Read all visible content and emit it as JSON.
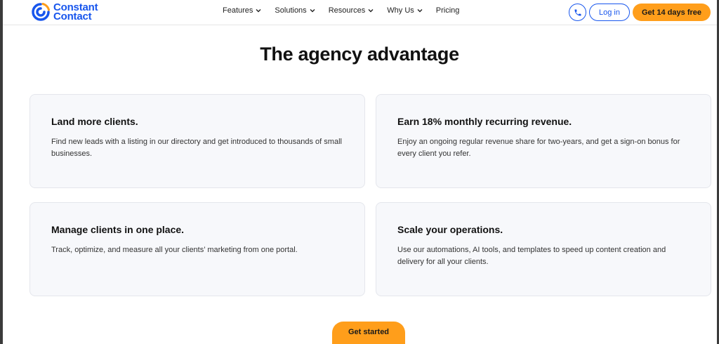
{
  "header": {
    "logo": {
      "line1": "Constant",
      "line2": "Contact"
    },
    "nav": [
      {
        "label": "Features",
        "has_dropdown": true
      },
      {
        "label": "Solutions",
        "has_dropdown": true
      },
      {
        "label": "Resources",
        "has_dropdown": true
      },
      {
        "label": "Why Us",
        "has_dropdown": true
      },
      {
        "label": "Pricing",
        "has_dropdown": false
      }
    ],
    "phone_icon": "phone-icon",
    "login_label": "Log in",
    "trial_label": "Get 14 days free"
  },
  "main": {
    "title": "The agency advantage",
    "cards": [
      {
        "title": "Land more clients.",
        "body": "Find new leads with a listing in our directory and get introduced to thousands of small businesses."
      },
      {
        "title": "Earn 18% monthly recurring revenue.",
        "body": "Enjoy an ongoing regular revenue share for two-years, and get a sign-on bonus for every client you refer."
      },
      {
        "title": "Manage clients in one place.",
        "body": "Track, optimize, and measure all your clients’ marketing from one portal."
      },
      {
        "title": "Scale your operations.",
        "body": "Use our automations, AI tools, and templates to speed up content creation and delivery for all your clients."
      }
    ],
    "cta_label": "Get started"
  },
  "colors": {
    "brand_blue": "#1856ed",
    "accent_orange": "#ff9e1b",
    "card_bg": "#f7f8fb"
  }
}
